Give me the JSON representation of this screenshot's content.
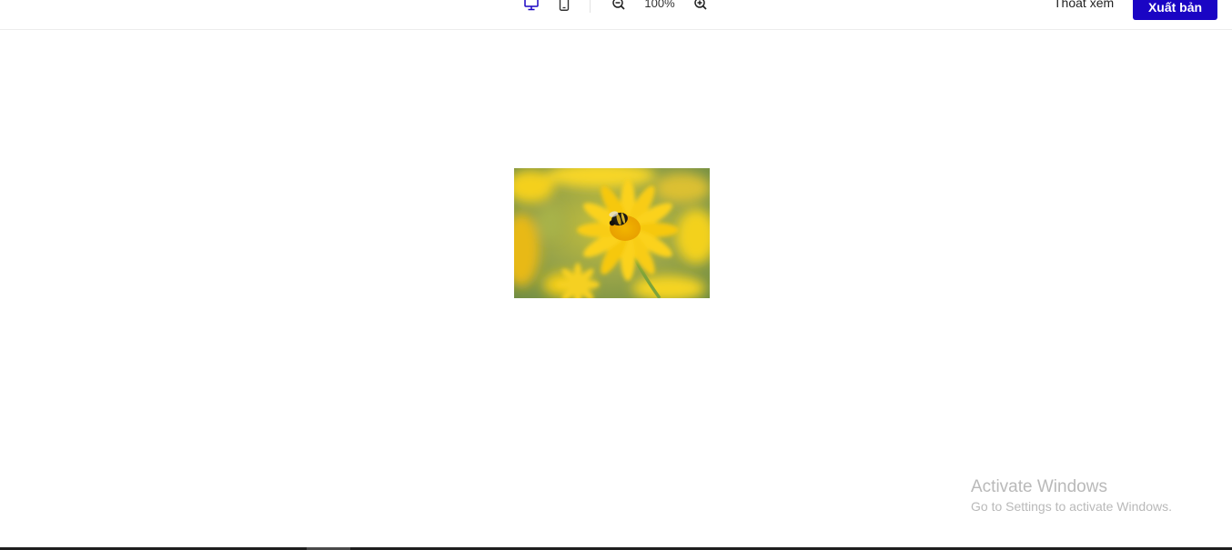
{
  "toolbar": {
    "zoom_level": "100%",
    "exit_label": "Thoát xem",
    "publish_label": "Xuất bản",
    "icons": [
      "desktop-icon",
      "mobile-icon",
      "zoom-out-icon",
      "zoom-in-icon"
    ],
    "active_view": "desktop",
    "accent_color": "#1a05c4"
  },
  "canvas": {
    "image_subject": "yellow flower with bee",
    "image_colors": [
      "#f5d21a",
      "#7a9a4a"
    ]
  },
  "watermark": {
    "title": "Activate Windows",
    "subtitle": "Go to Settings to activate Windows."
  }
}
